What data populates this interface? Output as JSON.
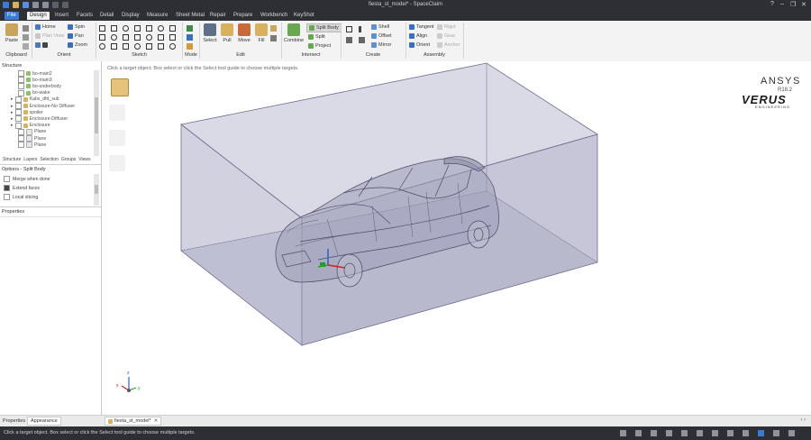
{
  "window": {
    "title": "fiesta_st_model* - SpaceClaim",
    "controls": [
      "?",
      "–",
      "❐",
      "✕"
    ]
  },
  "menu_tabs": [
    "File",
    "Design",
    "Insert",
    "Facets",
    "Detail",
    "Display",
    "Measure",
    "Sheet Metal",
    "Repair",
    "Prepare",
    "Workbench",
    "KeyShot"
  ],
  "active_tab": "Design",
  "ribbon": {
    "clipboard": {
      "label": "Clipboard",
      "paste": "Paste"
    },
    "orient": {
      "label": "Orient",
      "items": [
        "Home",
        "Plan View",
        "Spin",
        "Pan",
        "Zoom"
      ]
    },
    "sketch": {
      "label": "Sketch"
    },
    "mode": {
      "label": "Mode"
    },
    "edit": {
      "label": "Edit",
      "buttons": [
        "Select",
        "Pull",
        "Move",
        "Fill"
      ]
    },
    "intersect": {
      "label": "Intersect",
      "combine": "Combine",
      "items": [
        "Split Body",
        "Split",
        "Project"
      ]
    },
    "create": {
      "label": "Create",
      "items": [
        "Shell",
        "Offset",
        "Mirror"
      ]
    },
    "assembly": {
      "label": "Assembly",
      "items": [
        "Tangent",
        "Align",
        "Orient",
        "Rigid",
        "Gear",
        "Anchor"
      ]
    }
  },
  "structure_panel": {
    "header": "Structure",
    "tree": [
      {
        "label": "bo-main2",
        "icon": "body-icon"
      },
      {
        "label": "bo-main3",
        "icon": "body-icon"
      },
      {
        "label": "bo-underbody",
        "icon": "body-icon"
      },
      {
        "label": "bo-wake",
        "icon": "body-icon"
      },
      {
        "label": "Kabs_dfd_sub",
        "icon": "component-icon"
      },
      {
        "label": "Enclosure-No Diffuser",
        "icon": "component-icon"
      },
      {
        "label": "spoiler",
        "icon": "component-icon"
      },
      {
        "label": "Enclosure-Diffuser",
        "icon": "component-icon"
      },
      {
        "label": "Enclosure",
        "icon": "component-icon"
      },
      {
        "label": "Plane",
        "icon": "plane-icon"
      },
      {
        "label": "Plane",
        "icon": "plane-icon"
      },
      {
        "label": "Plane",
        "icon": "plane-icon"
      }
    ],
    "tabs": [
      "Structure",
      "Layers",
      "Selection",
      "Groups",
      "Views"
    ]
  },
  "options_panel": {
    "header": "Options - Split Body",
    "options": [
      {
        "label": "Merge when done",
        "checked": false
      },
      {
        "label": "Extend faces",
        "checked": true
      },
      {
        "label": "Local slicing",
        "checked": false
      }
    ]
  },
  "properties_panel": {
    "header": "Properties"
  },
  "bottom_left_tabs": [
    "Properties",
    "Appearance"
  ],
  "viewport": {
    "hint": "Click a target object.  Box select or click the Select tool guide to choose multiple targets.",
    "logo_brand": "ANSYS",
    "logo_version": "R18.2",
    "logo_company": "VERUS",
    "logo_tagline": "ENGINEERING",
    "axis_labels": {
      "x": "x",
      "y": "y",
      "z": "z"
    }
  },
  "document_tab": "fiesta_st_model*",
  "status_text": "Click a target object.  Box select or click the Select tool guide to choose multiple targets.",
  "colors": {
    "chrome": "#2d2f35",
    "ribbon_bg": "#f3f3f3",
    "enclosure_fill": "#b8b8d0",
    "enclosure_stroke": "#6d6d8f",
    "car_stroke": "#4a4a66",
    "accent_orange": "#e29a2a",
    "accent_blue": "#2a63c4"
  }
}
